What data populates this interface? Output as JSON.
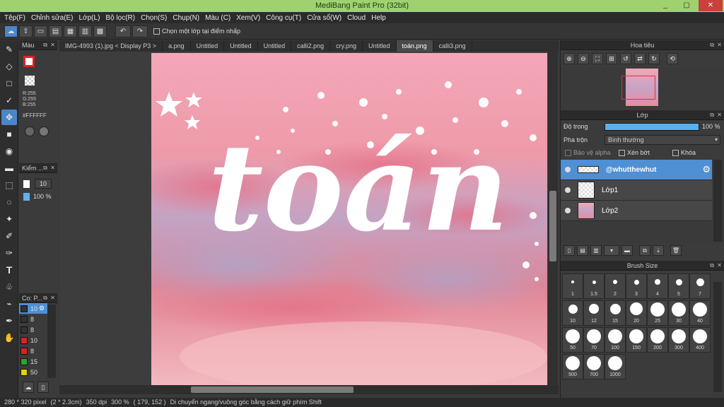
{
  "window": {
    "title": "MediBang Paint Pro (32bit)",
    "minimize": "_",
    "maximize": "▢",
    "close": "✕"
  },
  "menu": [
    "Tệp(F)",
    "Chỉnh sửa(E)",
    "Lớp(L)",
    "Bộ lọc(R)",
    "Chọn(S)",
    "Chụp(N)",
    "Màu (C)",
    "Xem(V)",
    "Công cụ(T)",
    "Cửa sổ(W)",
    "Cloud",
    "Help"
  ],
  "toolbar": {
    "option_label": "Chọn một lớp tại điểm nhấp",
    "option_checked": false
  },
  "color_panel": {
    "title": "Màu",
    "r": "R:255",
    "g": "G:255",
    "b": "B:255",
    "hex": "#FFFFFF",
    "primary": "#e02020",
    "secondary": "#ffffff"
  },
  "brush_panel": {
    "title": "Kiểm ...",
    "size": "10",
    "opacity": "100 %"
  },
  "color_list": {
    "title": "Co: P...",
    "items": [
      {
        "color": "#333333",
        "value": "10"
      },
      {
        "color": "#333333",
        "value": "8"
      },
      {
        "color": "#333333",
        "value": "8"
      },
      {
        "color": "#e02020",
        "value": "10"
      },
      {
        "color": "#e02020",
        "value": "8"
      },
      {
        "color": "#22aa22",
        "value": "15"
      },
      {
        "color": "#e6d000",
        "value": "50"
      }
    ]
  },
  "tabs": [
    "IMG-4993 (1).jpg < Display P3 >",
    "a.png",
    "Untitled",
    "Untitled",
    "Untitled",
    "calli2.png",
    "cry.png",
    "Untitled",
    "toán.png",
    "calli3.png"
  ],
  "active_tab": 8,
  "canvas": {
    "text": "toán"
  },
  "navigator": {
    "title": "Hoa tiêu"
  },
  "layers": {
    "title": "Lớp",
    "opacity_label": "Độ trong",
    "opacity_value": "100 %",
    "opacity_fraction": 1.0,
    "blend_label": "Pha trộn",
    "blend_value": "Bình thường",
    "protect_alpha": "Bảo vệ alpha",
    "clipping": "Xén bớt",
    "lock": "Khóa",
    "rows": [
      {
        "name": "@whutthewhut",
        "selected": true
      },
      {
        "name": "Lớp1",
        "selected": false
      },
      {
        "name": "Lớp2",
        "selected": false
      }
    ]
  },
  "brush_size": {
    "title": "Brush Size",
    "sizes": [
      "1",
      "1.5",
      "2",
      "3",
      "4",
      "5",
      "7",
      "10",
      "12",
      "15",
      "20",
      "25",
      "30",
      "40",
      "50",
      "70",
      "100",
      "150",
      "200",
      "300",
      "400",
      "500",
      "700",
      "1000"
    ]
  },
  "status": {
    "size": "280 * 320 pixel",
    "cm": "(2 * 2.3cm)",
    "dpi": "350 dpi",
    "zoom": "300 %",
    "coords": "( 179, 152 )",
    "hint": "Di chuyển ngang/vuông góc bằng cách giữ phím Shift"
  }
}
